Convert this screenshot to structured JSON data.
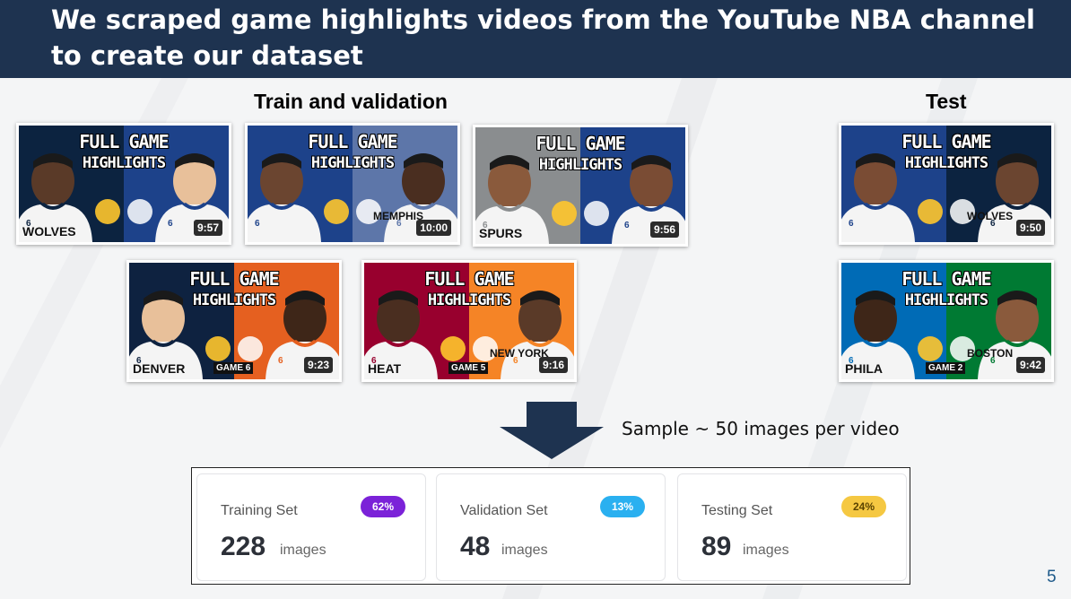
{
  "slide": {
    "title": "We scraped game highlights videos from the YouTube NBA channel to create our dataset",
    "page_number": "5",
    "train_label": "Train and validation",
    "test_label": "Test",
    "arrow_note": "Sample ~ 50 images per video"
  },
  "thumbnails": {
    "t1": {
      "headline1": "FULL GAME",
      "headline2": "HIGHLIGHTS",
      "jersey_left": "WOLVES",
      "jersey_right": "",
      "game": "",
      "duration": "9:57",
      "bg_left": "#0c2340",
      "bg_right": "#1d428a"
    },
    "t2": {
      "headline1": "FULL GAME",
      "headline2": "HIGHLIGHTS",
      "jersey_left": "",
      "jersey_right": "MEMPHIS",
      "game": "",
      "duration": "10:00",
      "bg_left": "#1d428a",
      "bg_right": "#5d76a9"
    },
    "t3": {
      "headline1": "FULL GAME",
      "headline2": "HIGHLIGHTS",
      "jersey_left": "SPURS",
      "jersey_right": "",
      "game": "",
      "duration": "9:56",
      "bg_left": "#8a8d8f",
      "bg_right": "#1d428a"
    },
    "t4": {
      "headline1": "FULL GAME",
      "headline2": "HIGHLIGHTS",
      "jersey_left": "DENVER",
      "jersey_right": "",
      "game": "GAME 6",
      "duration": "9:23",
      "bg_left": "#0e2240",
      "bg_right": "#e56020"
    },
    "t5": {
      "headline1": "FULL GAME",
      "headline2": "HIGHLIGHTS",
      "jersey_left": "HEAT",
      "jersey_right": "NEW YORK",
      "game": "GAME 5",
      "duration": "9:16",
      "bg_left": "#98002e",
      "bg_right": "#f58426"
    },
    "t6": {
      "headline1": "FULL GAME",
      "headline2": "HIGHLIGHTS",
      "jersey_left": "",
      "jersey_right": "WOLVES",
      "game": "",
      "duration": "9:50",
      "bg_left": "#1d428a",
      "bg_right": "#0c2340"
    },
    "t7": {
      "headline1": "FULL GAME",
      "headline2": "HIGHLIGHTS",
      "jersey_left": "PHILA",
      "jersey_right": "BOSTON",
      "game": "GAME 2",
      "duration": "9:42",
      "bg_left": "#006bb6",
      "bg_right": "#007a33"
    }
  },
  "stats": {
    "training": {
      "label": "Training Set",
      "badge": "62%",
      "value": "228",
      "unit": "images",
      "badge_color": "#7b22d8"
    },
    "validation": {
      "label": "Validation Set",
      "badge": "13%",
      "value": "48",
      "unit": "images",
      "badge_color": "#2ab0f0"
    },
    "testing": {
      "label": "Testing Set",
      "badge": "24%",
      "value": "89",
      "unit": "images",
      "badge_color": "#f5c842"
    }
  },
  "colors": {
    "header": "#1e3350",
    "arrow": "#1e3350",
    "accent": "#1e5a8a"
  }
}
